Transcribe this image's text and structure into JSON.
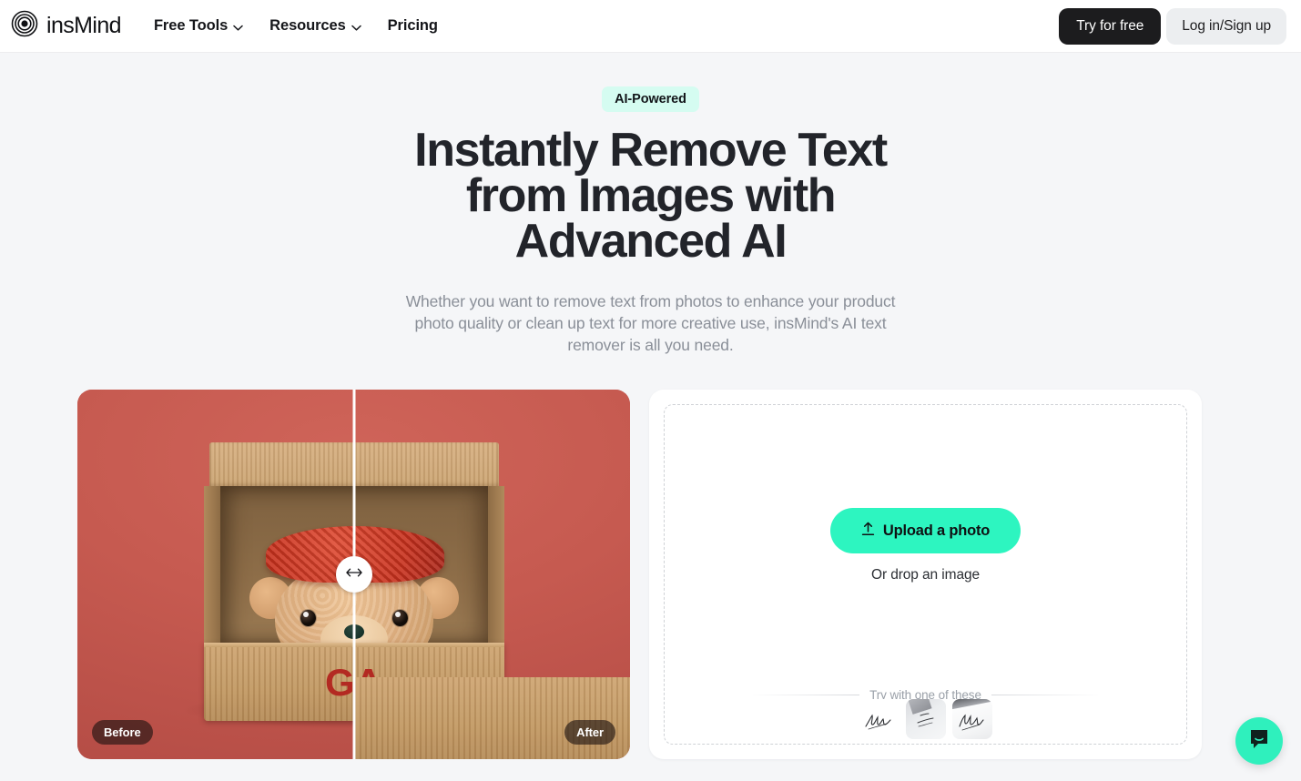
{
  "header": {
    "brand": "insMind",
    "logo_icon": "concentric-rings-logo-icon",
    "nav": [
      {
        "label": "Free Tools",
        "has_dropdown": true,
        "icon": "chevron-down-icon"
      },
      {
        "label": "Resources",
        "has_dropdown": true,
        "icon": "chevron-down-icon"
      },
      {
        "label": "Pricing",
        "has_dropdown": false
      }
    ],
    "try_button": "Try for free",
    "login_button": "Log in/Sign up"
  },
  "hero": {
    "badge": "AI-Powered",
    "title_line1": "Instantly Remove Text",
    "title_line2": "from Images with",
    "title_line3": "Advanced AI",
    "subtitle_line1": "Whether you want to remove text from photos to enhance your",
    "subtitle_line2": "product photo quality or clean up text for more creative use, insMind's",
    "subtitle_line3": "AI text remover is all you need."
  },
  "comparison": {
    "before_label": "Before",
    "after_label": "After",
    "handle_icon": "left-right-arrow-icon",
    "image_text_on_box": "GA",
    "image_description": "teddy-bear-in-cardboard-box"
  },
  "upload": {
    "button_label": "Upload a photo",
    "button_icon": "upload-arrow-icon",
    "drop_hint": "Or drop an image",
    "try_label": "Try with one of these",
    "samples": [
      {
        "name": "sample-handwriting-1"
      },
      {
        "name": "sample-handwriting-2"
      },
      {
        "name": "sample-handwriting-3"
      }
    ]
  },
  "chat": {
    "icon": "chat-bubble-icon"
  },
  "colors": {
    "accent_mint": "#2df5c0",
    "badge_mint": "#d5fcf1",
    "dark": "#1c1c1e",
    "page_bg": "#f5f6f8",
    "muted_text": "#8a8f98"
  }
}
